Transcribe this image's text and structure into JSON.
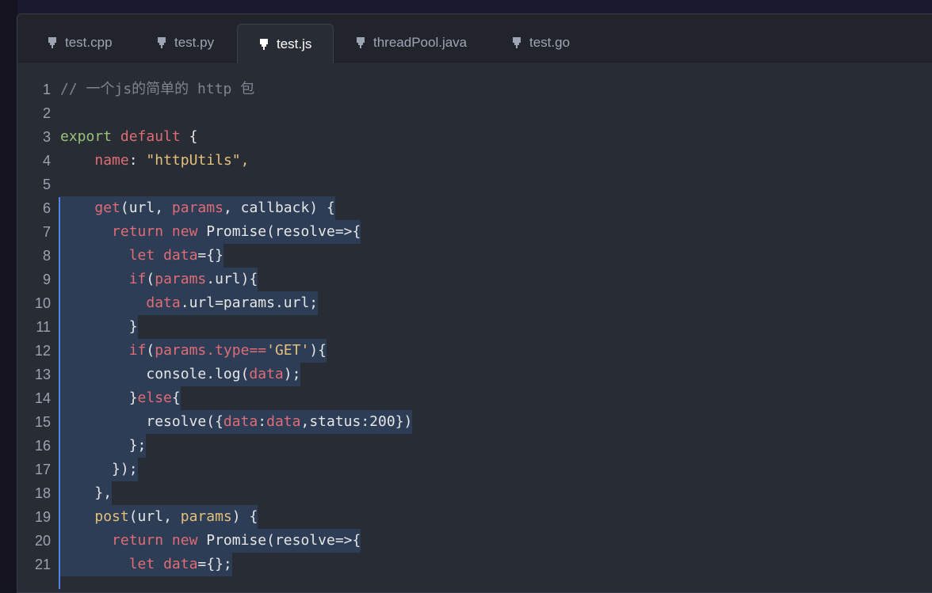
{
  "tabs": [
    {
      "label": "test.cpp",
      "active": false
    },
    {
      "label": "test.py",
      "active": false
    },
    {
      "label": "test.js",
      "active": true
    },
    {
      "label": "threadPool.java",
      "active": false
    },
    {
      "label": "test.go",
      "active": false
    }
  ],
  "tab_icon": "pin-icon",
  "colors": {
    "keyword": "#e06c75",
    "string": "#e5c07b",
    "comment": "#7f848e",
    "selection": "#2c3d55",
    "selection_bar": "#4f86e6",
    "background": "#282c34"
  },
  "editor": {
    "lines": [
      {
        "n": "1"
      },
      {
        "n": "2"
      },
      {
        "n": "3"
      },
      {
        "n": "4"
      },
      {
        "n": "5"
      },
      {
        "n": "6"
      },
      {
        "n": "7"
      },
      {
        "n": "8"
      },
      {
        "n": "9"
      },
      {
        "n": "10"
      },
      {
        "n": "11"
      },
      {
        "n": "12"
      },
      {
        "n": "13"
      },
      {
        "n": "14"
      },
      {
        "n": "15"
      },
      {
        "n": "16"
      },
      {
        "n": "17"
      },
      {
        "n": "18"
      },
      {
        "n": "19"
      },
      {
        "n": "20"
      },
      {
        "n": "21"
      }
    ],
    "code": {
      "l1": "// 一个js的简单的 http 包",
      "l3_kw1": "export",
      "l3_kw2": "default",
      "l3_rest": " {",
      "l4_key": "name",
      "l4_colon": ": ",
      "l4_str": "\"httpUtils\",",
      "l6_fn": "get",
      "l6_a": "(url, ",
      "l6_p": "params",
      "l6_b": ", callback) {",
      "l7_kw1": "return",
      "l7_kw2": "new",
      "l7_rest": " Promise(resolve=>{",
      "l8_kw": "let",
      "l8_var": "data",
      "l8_rest": "={}",
      "l9_kw": "if",
      "l9_a": "(",
      "l9_p": "params",
      "l9_b": ".url){",
      "l10_var": "data",
      "l10_rest": ".url=params.url;",
      "l11": "}",
      "l12_kw": "if",
      "l12_a": "(",
      "l12_p": "params.type==",
      "l12_s": "'GET'",
      "l12_b": "){",
      "l13_a": "console.log(",
      "l13_v": "data",
      "l13_b": ");",
      "l14_a": "}",
      "l14_kw": "else",
      "l14_b": "{",
      "l15_a": "resolve({",
      "l15_v1": "data",
      "l15_c": ":",
      "l15_v2": "data",
      "l15_b": ",status:200})",
      "l16": "};",
      "l17": "});",
      "l18": "},",
      "l19_fn": "post",
      "l19_a": "(url, ",
      "l19_p": "params",
      "l19_b": ") {",
      "l20_kw1": "return",
      "l20_kw2": "new",
      "l20_rest": " Promise(resolve=>{",
      "l21_kw": "let",
      "l21_var": "data",
      "l21_rest": "={};"
    }
  }
}
